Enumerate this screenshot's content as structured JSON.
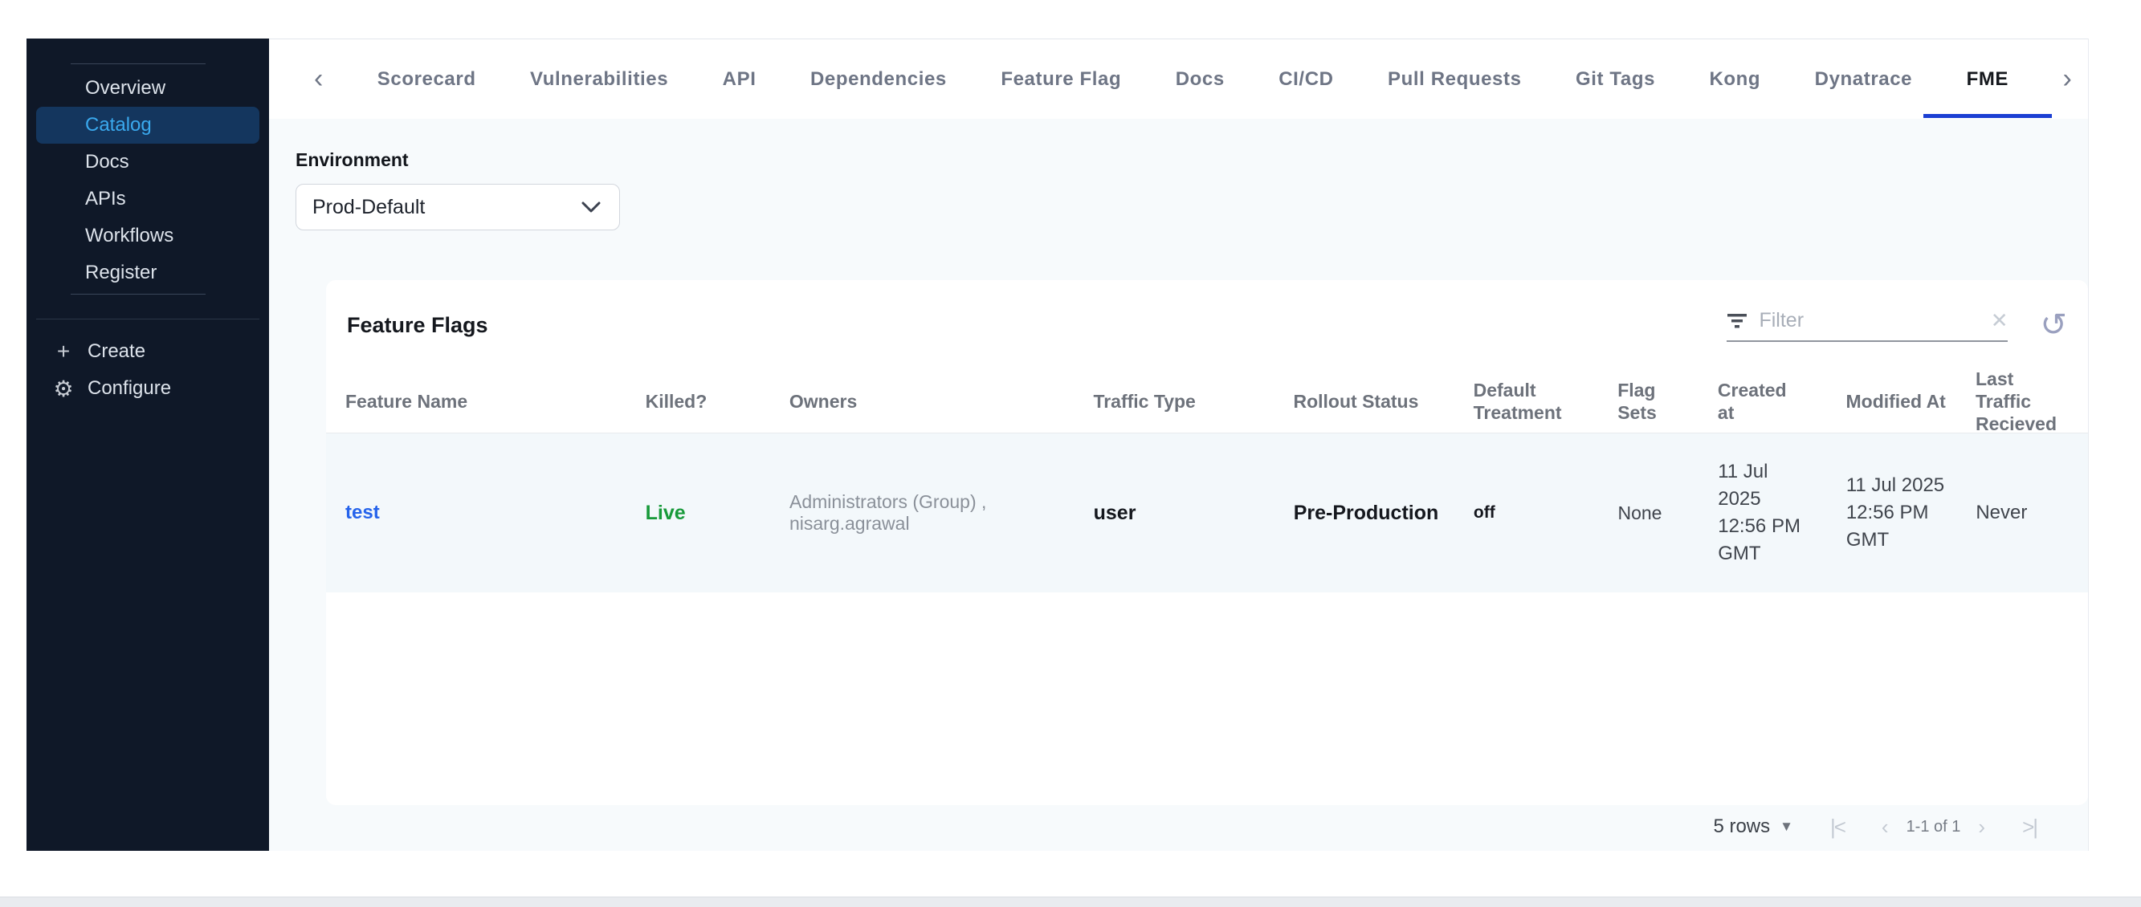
{
  "sidebar": {
    "items": [
      {
        "label": "Overview",
        "active": false
      },
      {
        "label": "Catalog",
        "active": true
      },
      {
        "label": "Docs",
        "active": false
      },
      {
        "label": "APIs",
        "active": false
      },
      {
        "label": "Workflows",
        "active": false
      },
      {
        "label": "Register",
        "active": false
      }
    ],
    "actions": [
      {
        "label": "Create",
        "icon": "plus-icon"
      },
      {
        "label": "Configure",
        "icon": "gear-icon"
      }
    ]
  },
  "tabs": {
    "items": [
      "Scorecard",
      "Vulnerabilities",
      "API",
      "Dependencies",
      "Feature Flag",
      "Docs",
      "CI/CD",
      "Pull Requests",
      "Git Tags",
      "Kong",
      "Dynatrace",
      "FME"
    ],
    "active": "FME"
  },
  "environment": {
    "label": "Environment",
    "selected": "Prod-Default"
  },
  "feature_flags": {
    "title": "Feature Flags",
    "filter_placeholder": "Filter",
    "columns": [
      "Feature Name",
      "Killed?",
      "Owners",
      "Traffic Type",
      "Rollout Status",
      "Default Treatment",
      "Flag Sets",
      "Created at",
      "Modified At",
      "Last Traffic Recieved"
    ],
    "rows": [
      {
        "feature_name": "test",
        "killed": "Live",
        "owners": "Administrators (Group) , nisarg.agrawal",
        "traffic_type": "user",
        "rollout_status": "Pre-Production",
        "default_treatment": "off",
        "flag_sets": "None",
        "created_at": "11 Jul 2025 12:56 PM GMT",
        "modified_at": "11 Jul 2025 12:56 PM GMT",
        "last_traffic_received": "Never"
      }
    ]
  },
  "pagination": {
    "rows_label": "5 rows",
    "range_label": "1-1 of 1"
  },
  "icons": {
    "back_chevron": "‹",
    "forward_chevron": "›",
    "clear": "✕",
    "refresh": "↺",
    "plus": "+",
    "gear": "⚙",
    "rows_caret": "▼",
    "first_page": "|<",
    "prev_page": "‹",
    "next_page": "›",
    "last_page": ">|"
  },
  "colors": {
    "sidebar_bg": "#0f1828",
    "sidebar_active_bg": "#14365e",
    "sidebar_active_text": "#3aa9ee",
    "tab_underline": "#1b3fd3",
    "link_blue": "#2563eb",
    "live_green": "#189a3a",
    "content_bg": "#f7fafc",
    "row_bg": "#f3f8fb"
  }
}
